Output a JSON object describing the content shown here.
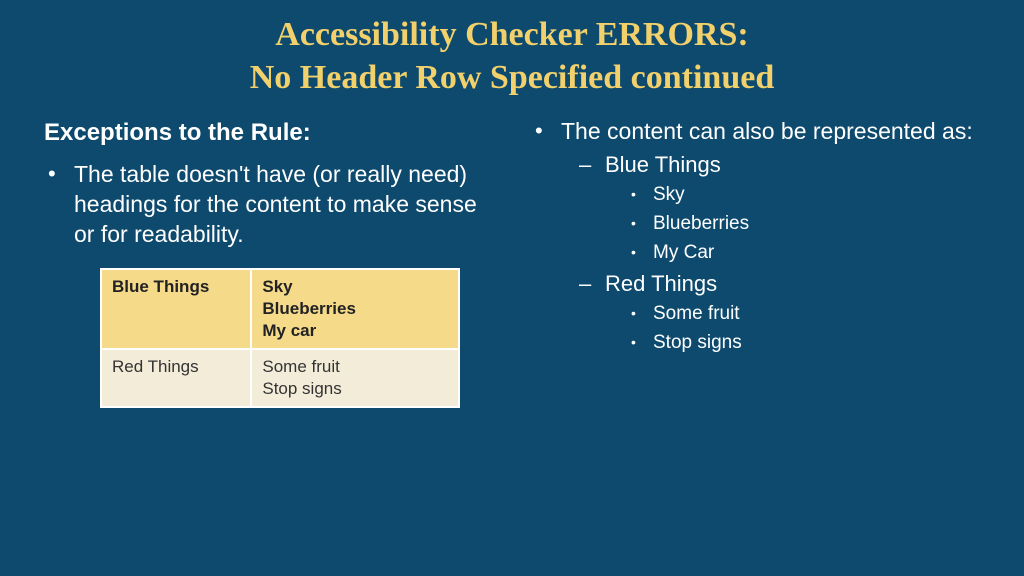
{
  "title_line1": "Accessibility Checker ERRORS:",
  "title_line2": "No Header Row Specified continued",
  "left": {
    "subhead": "Exceptions to the Rule:",
    "bullet1": "The table doesn't have (or really need) headings for the content to make sense or for readability."
  },
  "table": {
    "rows": [
      {
        "col1": "Blue Things",
        "col2_a": "Sky",
        "col2_b": "Blueberries",
        "col2_c": "My car"
      },
      {
        "col1": "Red Things",
        "col2_a": "Some fruit",
        "col2_b": "Stop signs"
      }
    ]
  },
  "right": {
    "bullet1": "The content can also be represented as:",
    "group1": {
      "label": "Blue Things",
      "items": [
        "Sky",
        "Blueberries",
        "My Car"
      ]
    },
    "group2": {
      "label": "Red Things",
      "items": [
        "Some fruit",
        "Stop signs"
      ]
    }
  }
}
